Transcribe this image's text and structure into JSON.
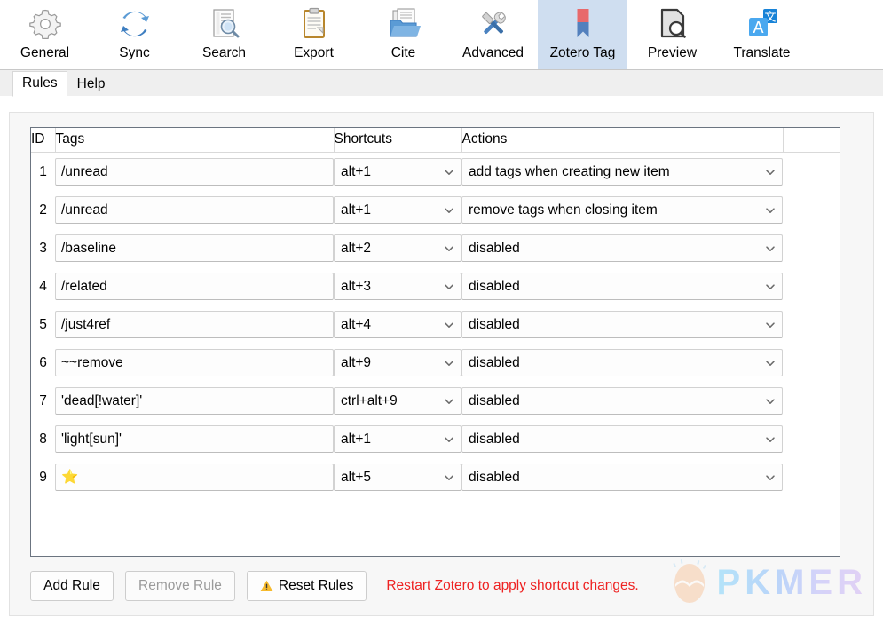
{
  "toolbar": {
    "tabs": [
      {
        "label": "General",
        "icon": "gear-icon",
        "selected": false
      },
      {
        "label": "Sync",
        "icon": "sync-icon",
        "selected": false
      },
      {
        "label": "Search",
        "icon": "search-doc-icon",
        "selected": false
      },
      {
        "label": "Export",
        "icon": "clipboard-icon",
        "selected": false
      },
      {
        "label": "Cite",
        "icon": "folder-doc-icon",
        "selected": false
      },
      {
        "label": "Advanced",
        "icon": "tools-icon",
        "selected": false
      },
      {
        "label": "Zotero Tag",
        "icon": "bookmark-icon",
        "selected": true
      },
      {
        "label": "Preview",
        "icon": "preview-icon",
        "selected": false
      },
      {
        "label": "Translate",
        "icon": "translate-icon",
        "selected": false
      }
    ]
  },
  "subtabs": [
    {
      "label": "Rules",
      "active": true
    },
    {
      "label": "Help",
      "active": false
    }
  ],
  "table": {
    "headers": [
      "ID",
      "Tags",
      "Shortcuts",
      "Actions"
    ],
    "rows": [
      {
        "id": "1",
        "tag": "/unread",
        "shortcut": "alt+1",
        "action": "add tags when creating new item"
      },
      {
        "id": "2",
        "tag": "/unread",
        "shortcut": "alt+1",
        "action": "remove tags when closing item"
      },
      {
        "id": "3",
        "tag": "/baseline",
        "shortcut": "alt+2",
        "action": "disabled"
      },
      {
        "id": "4",
        "tag": "/related",
        "shortcut": "alt+3",
        "action": "disabled"
      },
      {
        "id": "5",
        "tag": "/just4ref",
        "shortcut": "alt+4",
        "action": "disabled"
      },
      {
        "id": "6",
        "tag": "~~remove",
        "shortcut": "alt+9",
        "action": "disabled"
      },
      {
        "id": "7",
        "tag": "'dead[!water]'",
        "shortcut": "ctrl+alt+9",
        "action": "disabled"
      },
      {
        "id": "8",
        "tag": "'light[sun]'",
        "shortcut": "alt+1",
        "action": "disabled"
      },
      {
        "id": "9",
        "tag": "⭐",
        "shortcut": "alt+5",
        "action": "disabled"
      }
    ]
  },
  "buttons": {
    "add_rule": "Add Rule",
    "remove_rule": "Remove Rule",
    "reset_rules": "Reset Rules"
  },
  "restart_note": "Restart Zotero to apply shortcut changes.",
  "watermark": {
    "text": "PKMER"
  },
  "colors": {
    "selected_tab_bg": "#cfdef0",
    "warning_text": "#ee2222",
    "panel_bg": "#f7f7f7",
    "table_border": "#6b7480",
    "star": "#f7cf46"
  }
}
